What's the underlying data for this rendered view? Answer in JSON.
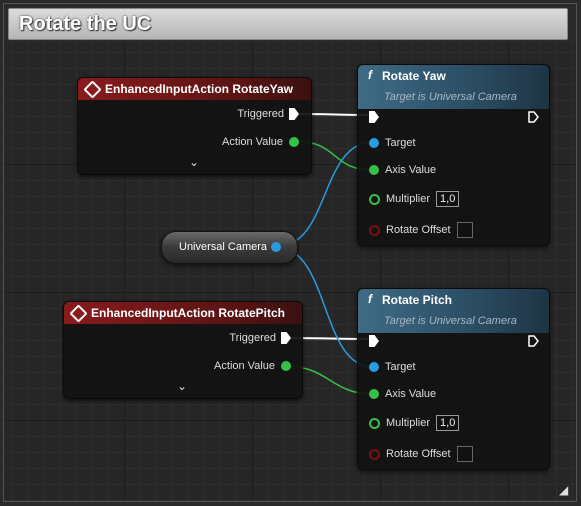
{
  "comment": {
    "title": "Rotate the UC"
  },
  "nodes": {
    "event_yaw": {
      "title": "EnhancedInputAction RotateYaw",
      "pins": {
        "triggered": "Triggered",
        "action_value": "Action Value"
      }
    },
    "event_pitch": {
      "title": "EnhancedInputAction RotatePitch",
      "pins": {
        "triggered": "Triggered",
        "action_value": "Action Value"
      }
    },
    "variable": {
      "label": "Universal Camera"
    },
    "rotate_yaw": {
      "icon": "f",
      "title": "Rotate Yaw",
      "subtitle": "Target is Universal Camera",
      "pins": {
        "target": "Target",
        "axis_value": "Axis Value",
        "multiplier": "Multiplier",
        "multiplier_value": "1,0",
        "rotate_offset": "Rotate Offset"
      }
    },
    "rotate_pitch": {
      "icon": "f",
      "title": "Rotate Pitch",
      "subtitle": "Target is Universal Camera",
      "pins": {
        "target": "Target",
        "axis_value": "Axis Value",
        "multiplier": "Multiplier",
        "multiplier_value": "1,0",
        "rotate_offset": "Rotate Offset"
      }
    }
  },
  "colors": {
    "exec": "#ffffff",
    "float": "#35c04a",
    "object": "#2b9be0",
    "event_header": "#8a1b1b",
    "function_header": "#3f6b86"
  }
}
